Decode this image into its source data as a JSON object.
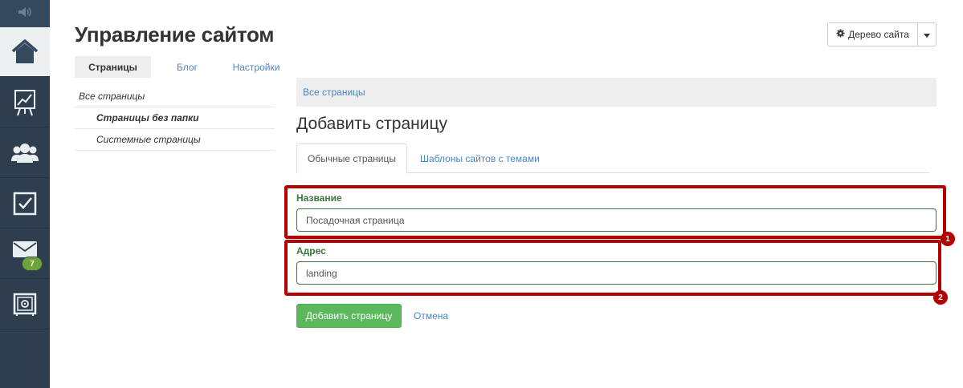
{
  "header": {
    "title": "Управление сайтом",
    "tree_button_label": "Дерево сайта"
  },
  "top_tabs": [
    {
      "label": "Страницы",
      "active": true
    },
    {
      "label": "Блог",
      "active": false
    },
    {
      "label": "Настройки",
      "active": false
    }
  ],
  "sidebar": {
    "icons": [
      "speaker-icon",
      "home-icon",
      "chart-icon",
      "users-icon",
      "checkbox-icon",
      "mail-icon",
      "safe-icon"
    ],
    "mail_badge": "7"
  },
  "page_tree": [
    {
      "label": "Все страницы"
    },
    {
      "label": "Страницы без папки"
    },
    {
      "label": "Системные страницы"
    }
  ],
  "breadcrumb": "Все страницы",
  "form": {
    "title": "Добавить страницу",
    "tabs": [
      {
        "label": "Обычные страницы",
        "active": true
      },
      {
        "label": "Шаблоны сайтов с темами",
        "active": false
      }
    ],
    "name_label": "Название",
    "name_value": "Посадочная страница",
    "address_label": "Адрес",
    "address_value": "landing",
    "submit_label": "Добавить страницу",
    "cancel_label": "Отмена"
  },
  "annotations": [
    {
      "number": "1"
    },
    {
      "number": "2"
    }
  ],
  "colors": {
    "sidebar": "#2e3e4f",
    "success_green": "#5cb85c",
    "label_green": "#3c763d",
    "link_blue": "#4a86c5",
    "highlight_red": "#b30000",
    "badge_green": "#6ea337"
  }
}
